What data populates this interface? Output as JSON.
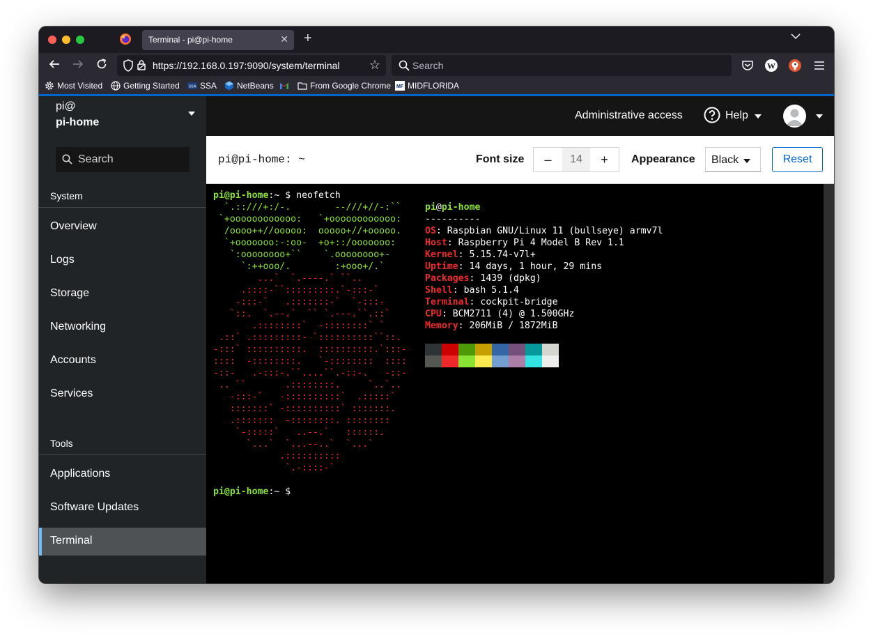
{
  "browser": {
    "tab_title": "Terminal - pi@pi-home",
    "url": "https://192.168.0.197:9090/system/terminal",
    "search_placeholder": "Search",
    "bookmarks": [
      "Most Visited",
      "Getting Started",
      "SSA",
      "NetBeans",
      "From Google Chrome",
      "MIDFLORIDA"
    ]
  },
  "sidebar": {
    "user": "pi@",
    "host": "pi-home",
    "search_placeholder": "Search",
    "system_title": "System",
    "system_items": [
      "Overview",
      "Logs",
      "Storage",
      "Networking",
      "Accounts",
      "Services"
    ],
    "tools_title": "Tools",
    "tools_items": [
      "Applications",
      "Software Updates",
      "Terminal"
    ],
    "active_item": "Terminal"
  },
  "masthead": {
    "admin_access": "Administrative access",
    "help": "Help"
  },
  "toolbar": {
    "title": "pi@pi-home: ~",
    "font_size_label": "Font size",
    "font_size_minus": "–",
    "font_size_value": "14",
    "font_size_plus": "+",
    "appearance_label": "Appearance",
    "appearance_value": "Black",
    "reset_label": "Reset"
  },
  "terminal": {
    "prompt_user_host": "pi@pi-home",
    "prompt_path": ":~",
    "prompt_symbol": " $",
    "command": "neofetch",
    "logo_green": [
      "  `.::///+:/-.        --///+//-:``",
      " `+oooooooooooo:   `+oooooooooooo:",
      "  /oooo++//ooooo:  ooooo+//+ooooo.",
      "  `+ooooooo:-:oo-  +o+::/ooooooo:",
      "   `:oooooooo+``    `.oooooooo+-",
      "     `:++ooo/.        :+ooo+/.`"
    ],
    "logo_red": [
      "        ...`  `.----.` ``..",
      "     .::::-``:::::::::.`-:::-`",
      "    -:::-`   .:::::::-`  `-:::-",
      "   `::.  `.--.`  `` `.---.``.::`",
      "       .::::::::`  -::::::::` `",
      " .::` .:::::::::- `::::::::::``::.",
      "-:::` ::::::::::.  ::::::::::.`:::-",
      "::::  -::::::::.   `-::::::::  ::::",
      "-::-   .-:::-.``....``.-::-.   -::-",
      " .. ``       .::::::::.     `..`..",
      "   -:::-`   -::::::::::`  .:::::`",
      "   :::::::` -::::::::::` :::::::.",
      "   .:::::::  -::::::::. ::::::::",
      "    `-:::::`   ..--.`   ::::::.",
      "      `...`  `...--..`  `...`",
      "            .::::::::::",
      "             `.-::::-`"
    ],
    "info_user": "pi",
    "info_at": "@",
    "info_host": "pi-home",
    "info_separator": "----------",
    "info": [
      {
        "key": "OS",
        "value": "Raspbian GNU/Linux 11 (bullseye) armv7l"
      },
      {
        "key": "Host",
        "value": "Raspberry Pi 4 Model B Rev 1.1"
      },
      {
        "key": "Kernel",
        "value": "5.15.74-v7l+"
      },
      {
        "key": "Uptime",
        "value": "14 days, 1 hour, 29 mins"
      },
      {
        "key": "Packages",
        "value": "1439 (dpkg)"
      },
      {
        "key": "Shell",
        "value": "bash 5.1.4"
      },
      {
        "key": "Terminal",
        "value": "cockpit-bridge"
      },
      {
        "key": "CPU",
        "value": "BCM2711 (4) @ 1.500GHz"
      },
      {
        "key": "Memory",
        "value": "206MiB / 1872MiB"
      }
    ],
    "palette_dark": [
      "#2e3436",
      "#cc0000",
      "#4e9a06",
      "#c4a000",
      "#3465a4",
      "#75507b",
      "#06989a",
      "#d3d7cf"
    ],
    "palette_bright": [
      "#555753",
      "#ef2929",
      "#8ae234",
      "#fce94f",
      "#729fcf",
      "#ad7fa8",
      "#34e2e2",
      "#eeeeec"
    ]
  },
  "colors": {
    "accent": "#0066cc",
    "sidebar_active_bar": "#73bcf7",
    "prompt_green": "#8ae234",
    "logo_red": "#ef2929"
  }
}
